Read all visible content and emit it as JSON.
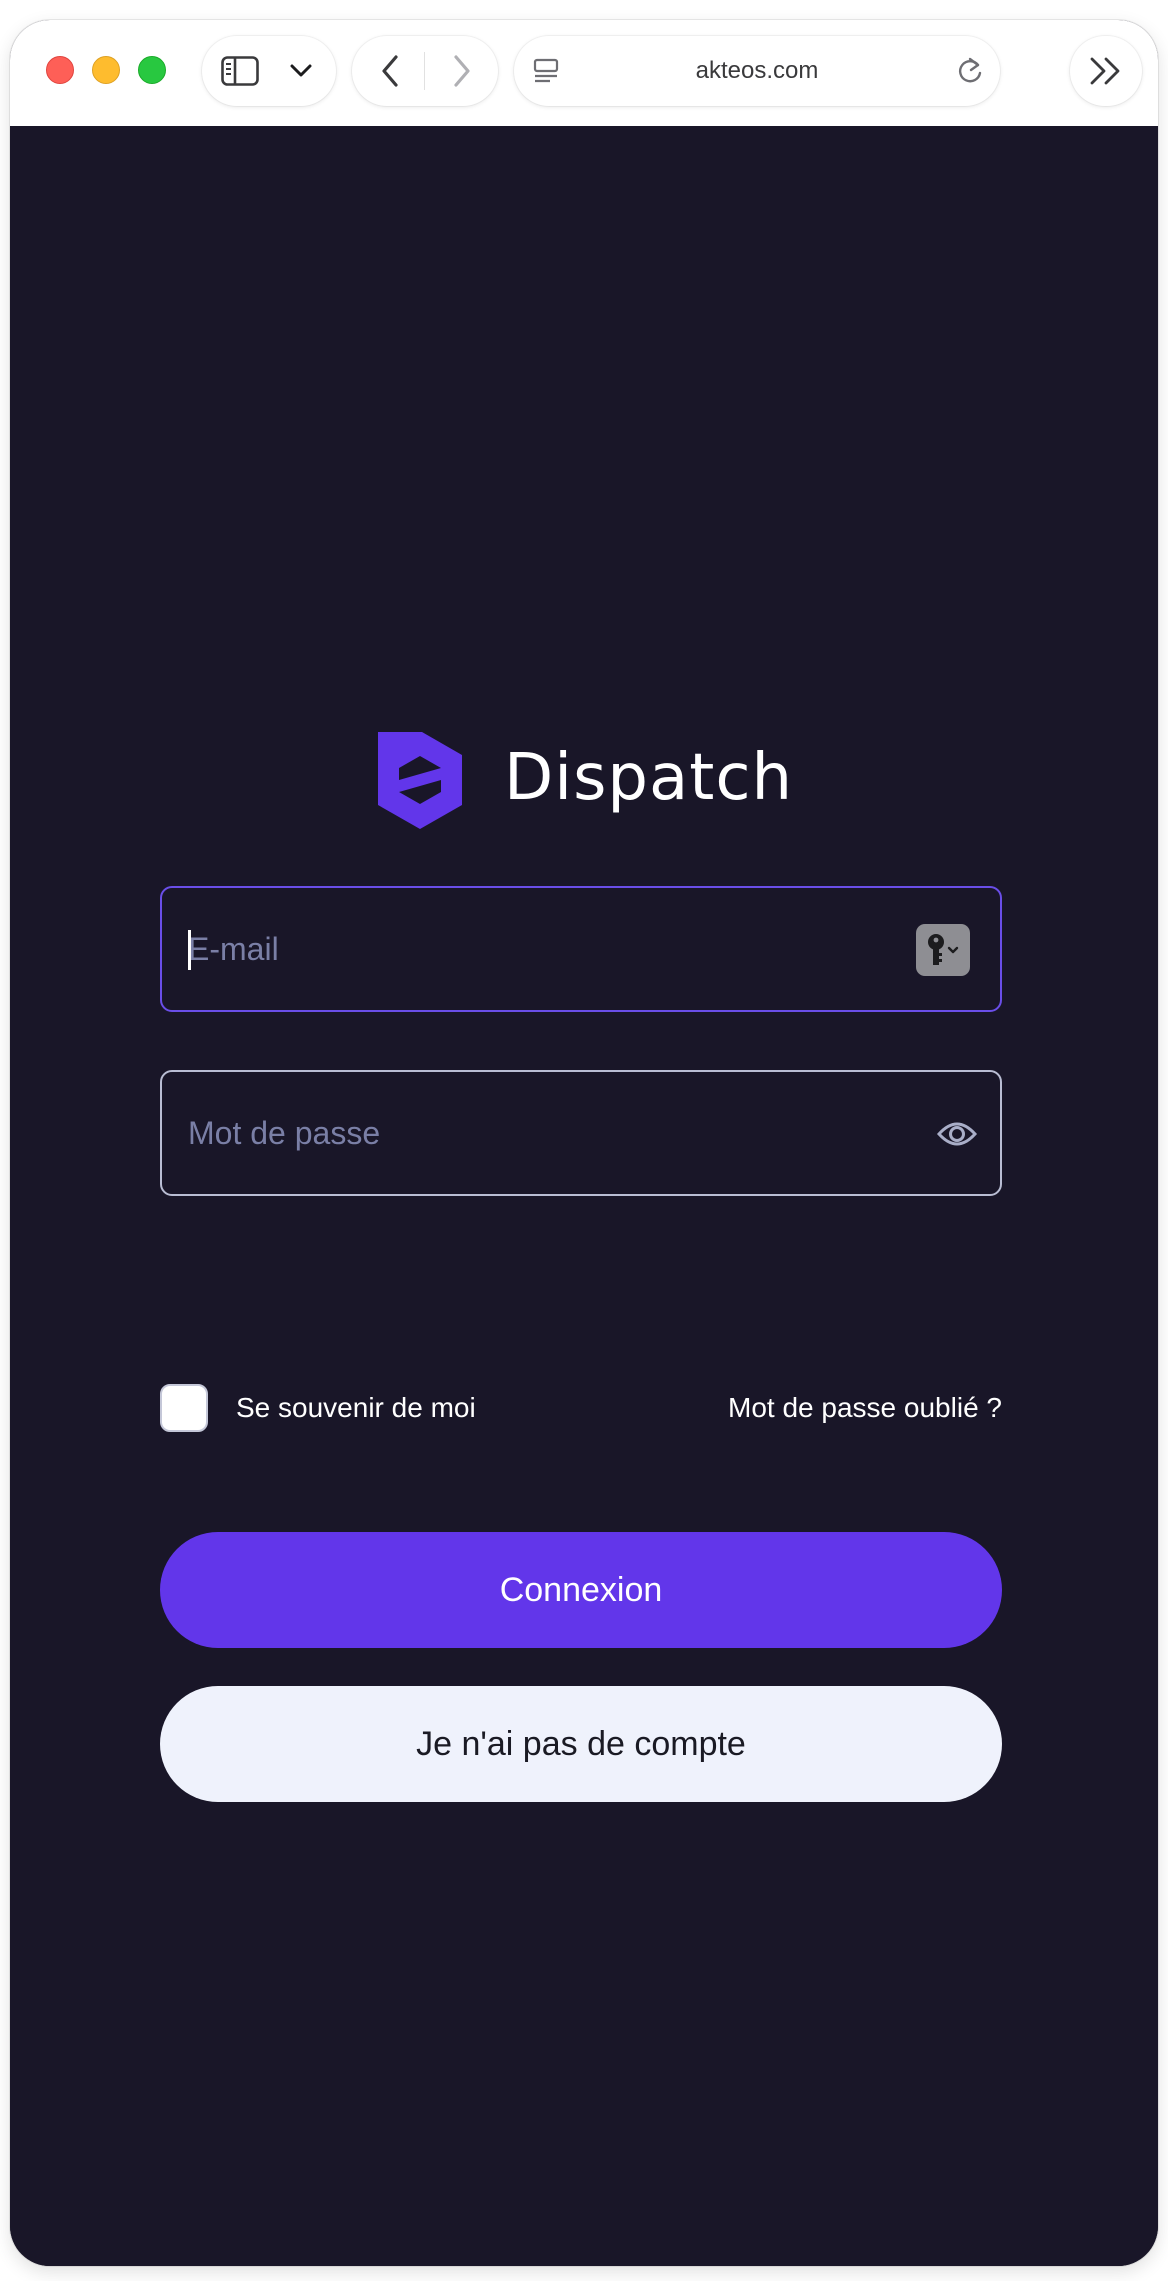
{
  "browser": {
    "url": "akteos.com"
  },
  "brand": {
    "name": "Dispatch",
    "logo_color": "#6236ea"
  },
  "login": {
    "email_placeholder": "E-mail",
    "password_placeholder": "Mot de passe",
    "remember_label": "Se souvenir de moi",
    "remember_checked": false,
    "forgot_label": "Mot de passe oublié ?",
    "submit_label": "Connexion",
    "signup_label": "Je n'ai pas de compte"
  },
  "colors": {
    "background": "#191628",
    "accent": "#6236ea",
    "focus_border": "#6a4ee8",
    "secondary_button": "#eff2fc"
  },
  "icons": {
    "sidebar": "sidebar-icon",
    "chevron": "chevron-down-icon",
    "back": "back-arrow-icon",
    "forward": "forward-arrow-icon",
    "reader": "reader-icon",
    "reload": "reload-icon",
    "more": "double-chevron-icon",
    "password_manager": "key-icon",
    "show_password": "eye-icon"
  }
}
